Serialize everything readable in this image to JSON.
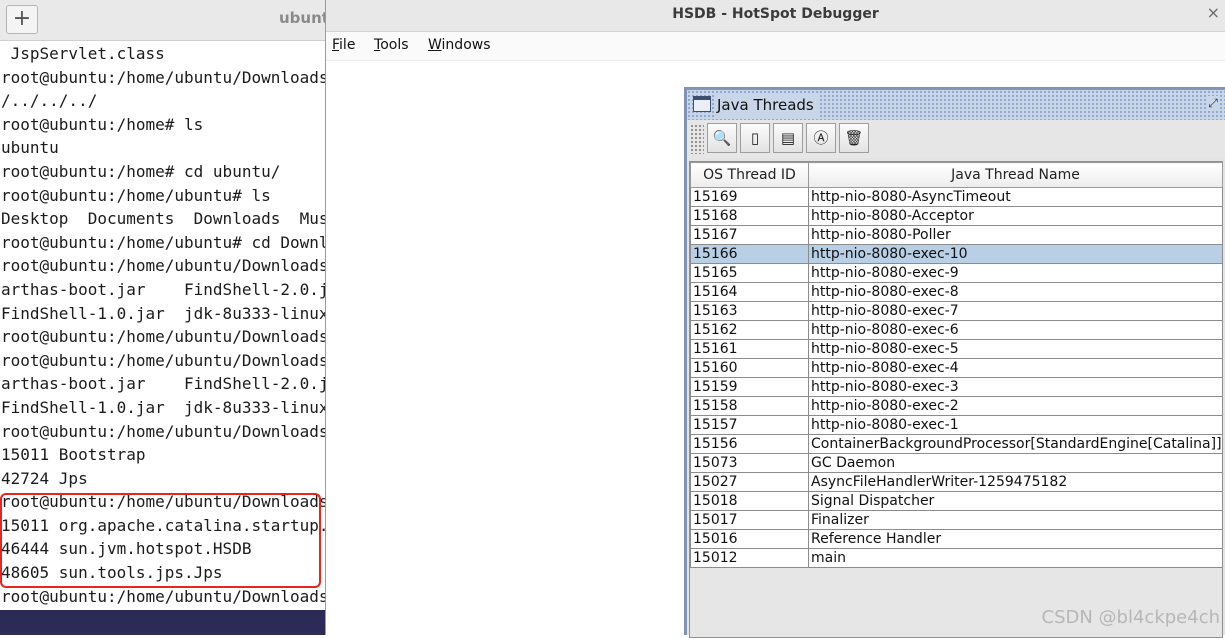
{
  "terminal": {
    "title": "ubunt",
    "new_tab_label": "+",
    "lines": [
      " JspServlet.class",
      "root@ubuntu:/home/ubuntu/Downloads",
      "/../../../",
      "root@ubuntu:/home# ls",
      "ubuntu",
      "root@ubuntu:/home# cd ubuntu/",
      "root@ubuntu:/home/ubuntu# ls",
      "Desktop  Documents  Downloads  Mus",
      "root@ubuntu:/home/ubuntu# cd Downl",
      "root@ubuntu:/home/ubuntu/Downloads",
      "arthas-boot.jar    FindShell-2.0.j",
      "FindShell-1.0.jar  jdk-8u333-linux",
      "root@ubuntu:/home/ubuntu/Downloads",
      "root@ubuntu:/home/ubuntu/Downloads",
      "arthas-boot.jar    FindShell-2.0.j",
      "FindShell-1.0.jar  jdk-8u333-linux",
      "root@ubuntu:/home/ubuntu/Downloads",
      "15011 Bootstrap",
      "42724 Jps",
      "root@ubuntu:/home/ubuntu/Downloads",
      "15011 org.apache.catalina.startup.",
      "46444 sun.jvm.hotspot.HSDB",
      "48605 sun.tools.jps.Jps",
      "root@ubuntu:/home/ubuntu/Downloads"
    ]
  },
  "hsdb": {
    "title": "HSDB - HotSpot Debugger",
    "close_glyph": "×",
    "menu": [
      {
        "mnemonic": "F",
        "rest": "ile"
      },
      {
        "mnemonic": "T",
        "rest": "ools"
      },
      {
        "mnemonic": "W",
        "rest": "indows"
      }
    ]
  },
  "java_threads": {
    "title": "Java Threads",
    "maximize_glyph": "⤢",
    "toolbar_icons": [
      "inspect-thread-icon",
      "stack-memory-icon",
      "show-frames-icon",
      "thread-info-icon",
      "delete-icon"
    ],
    "toolbar_glyphs": [
      "🔍",
      "▯",
      "▤",
      "Ⓐ",
      "🗑"
    ],
    "columns": [
      "OS Thread ID",
      "Java Thread Name"
    ],
    "selected_row": 3,
    "rows": [
      {
        "id": "15169",
        "name": "http-nio-8080-AsyncTimeout"
      },
      {
        "id": "15168",
        "name": "http-nio-8080-Acceptor"
      },
      {
        "id": "15167",
        "name": "http-nio-8080-Poller"
      },
      {
        "id": "15166",
        "name": "http-nio-8080-exec-10"
      },
      {
        "id": "15165",
        "name": "http-nio-8080-exec-9"
      },
      {
        "id": "15164",
        "name": "http-nio-8080-exec-8"
      },
      {
        "id": "15163",
        "name": "http-nio-8080-exec-7"
      },
      {
        "id": "15162",
        "name": "http-nio-8080-exec-6"
      },
      {
        "id": "15161",
        "name": "http-nio-8080-exec-5"
      },
      {
        "id": "15160",
        "name": "http-nio-8080-exec-4"
      },
      {
        "id": "15159",
        "name": "http-nio-8080-exec-3"
      },
      {
        "id": "15158",
        "name": "http-nio-8080-exec-2"
      },
      {
        "id": "15157",
        "name": "http-nio-8080-exec-1"
      },
      {
        "id": "15156",
        "name": "ContainerBackgroundProcessor[StandardEngine[Catalina]]"
      },
      {
        "id": "15073",
        "name": "GC Daemon"
      },
      {
        "id": "15027",
        "name": "AsyncFileHandlerWriter-1259475182"
      },
      {
        "id": "15018",
        "name": "Signal Dispatcher"
      },
      {
        "id": "15017",
        "name": "Finalizer"
      },
      {
        "id": "15016",
        "name": "Reference Handler"
      },
      {
        "id": "15012",
        "name": "main"
      }
    ]
  },
  "watermark": "CSDN @bl4ckpe4ch"
}
